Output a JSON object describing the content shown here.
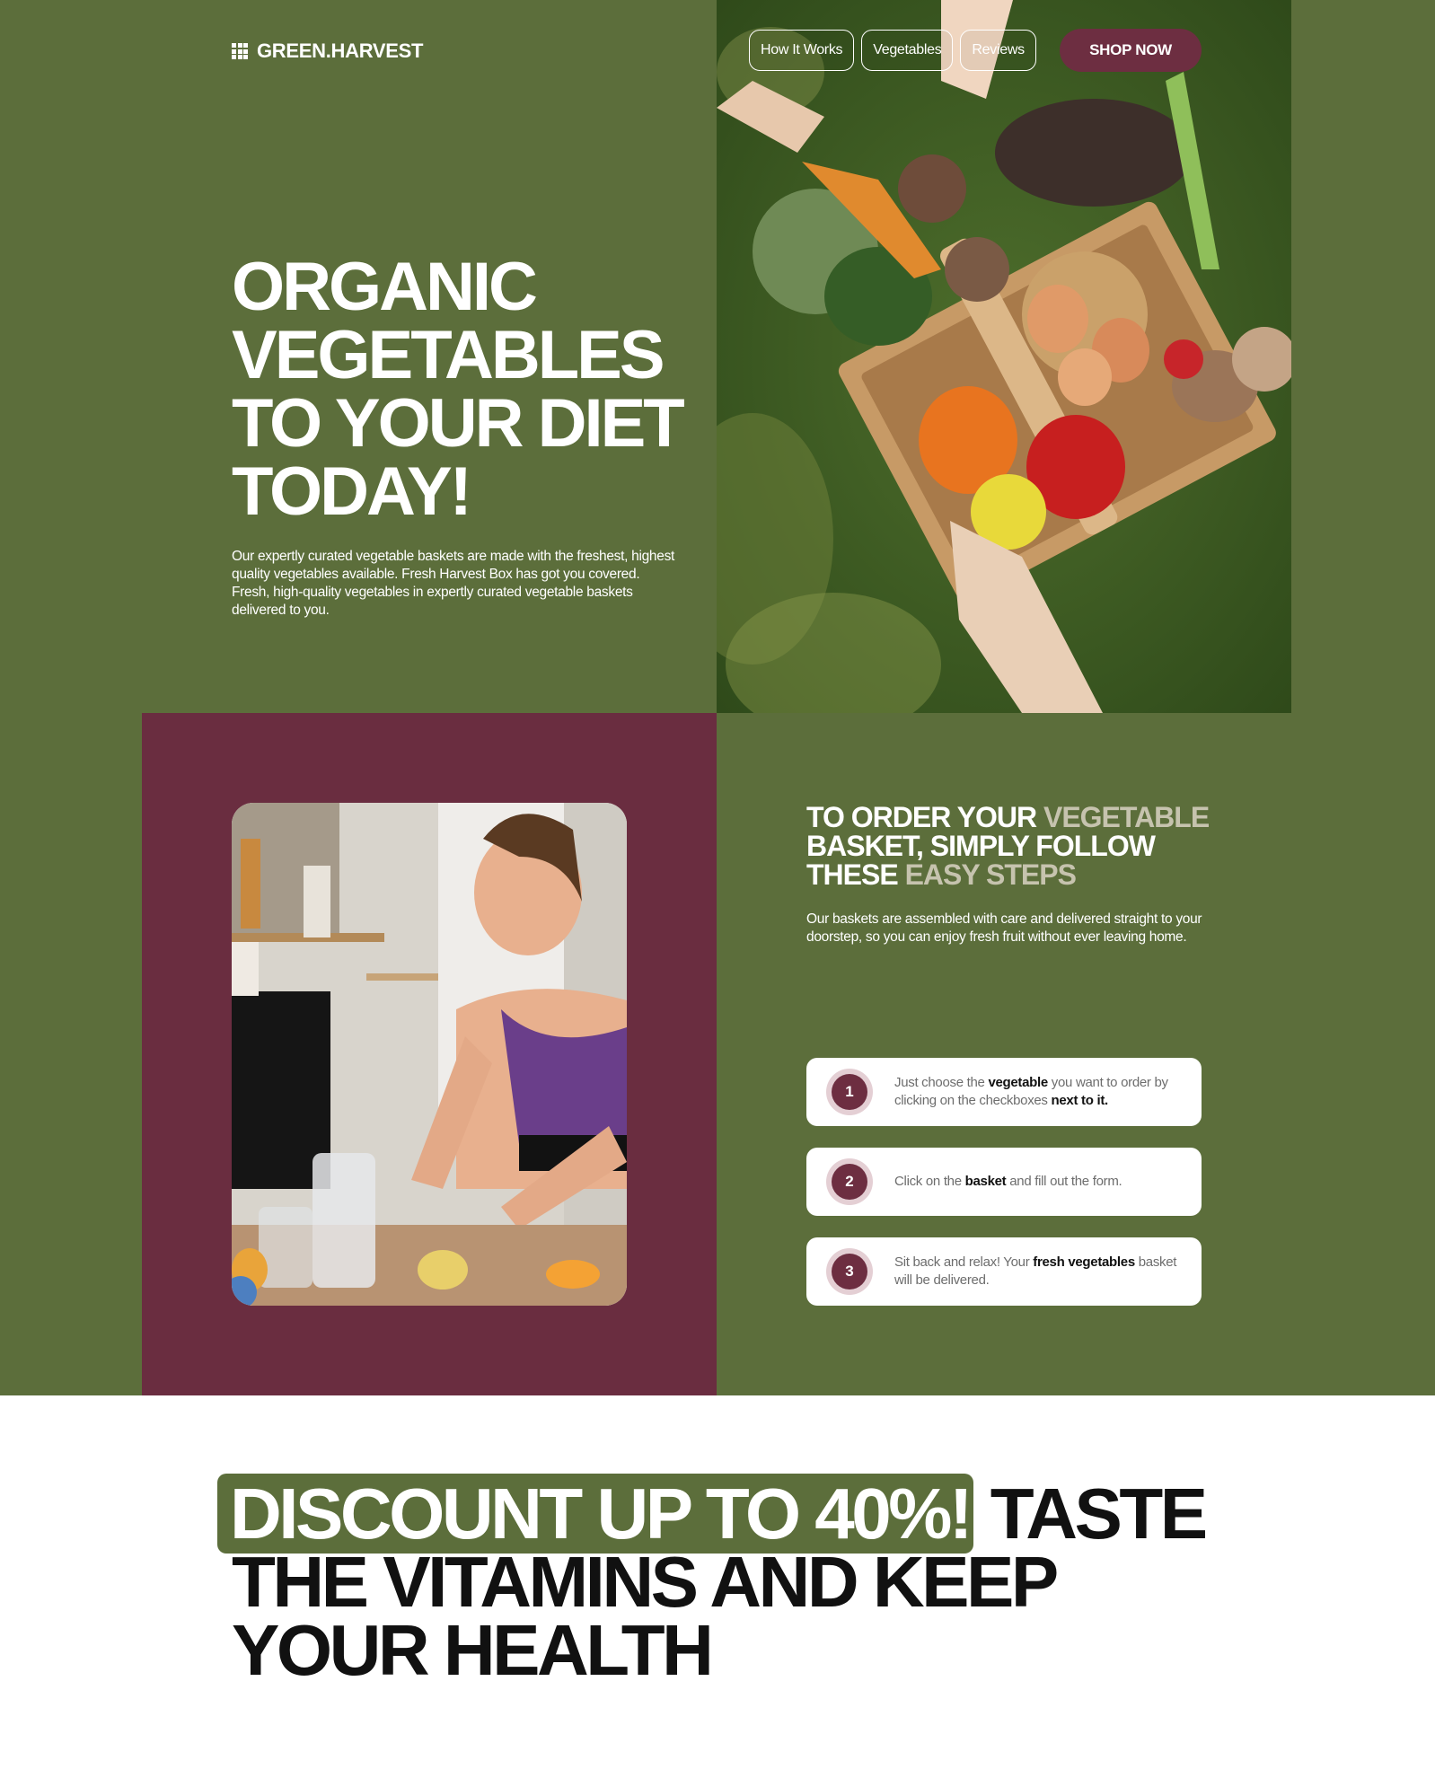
{
  "brand": {
    "name": "GREEN.HARVEST",
    "icon": "grid-icon"
  },
  "nav": {
    "links": [
      "How It Works",
      "Vegetables",
      "Reviews"
    ],
    "cta": "SHOP NOW"
  },
  "hero": {
    "title_lines": [
      "ORGANIC",
      "VEGETABLES",
      "TO YOUR DIET",
      "TODAY!"
    ],
    "description": "Our expertly curated vegetable baskets are made with the freshest, highest quality vegetables available. Fresh Harvest Box has got you covered. Fresh, high-quality vegetables in expertly curated vegetable baskets delivered to you."
  },
  "steps_section": {
    "title": {
      "part1": "TO ORDER YOUR ",
      "part2": "VEGETABLE",
      "part3": " BASKET, SIMPLY FOLLOW THESE ",
      "part4": "EASY STEPS"
    },
    "description": "Our baskets are assembled with care and delivered straight to your doorstep, so you can enjoy fresh fruit without ever leaving home.",
    "steps": [
      {
        "number": "1",
        "t1": "Just choose the ",
        "b1": "vegetable",
        "t2": " you want to order by clicking on the checkboxes ",
        "b2": "next to it.",
        "t3": ""
      },
      {
        "number": "2",
        "t1": "Click on the ",
        "b1": "basket",
        "t2": " and fill out the form.",
        "b2": "",
        "t3": ""
      },
      {
        "number": "3",
        "t1": "Sit back and relax! Your ",
        "b1": "fresh vegetables",
        "t2": " basket will be delivered.",
        "b2": "",
        "t3": ""
      }
    ]
  },
  "discount": {
    "highlight": "DISCOUNT UP TO 40%!",
    "rest": " TASTE THE VITAMINS AND KEEP YOUR HEALTH"
  },
  "colors": {
    "olive": "#5c6e3b",
    "wine": "#6a2d40",
    "muted_title": "#c6c3ae"
  }
}
